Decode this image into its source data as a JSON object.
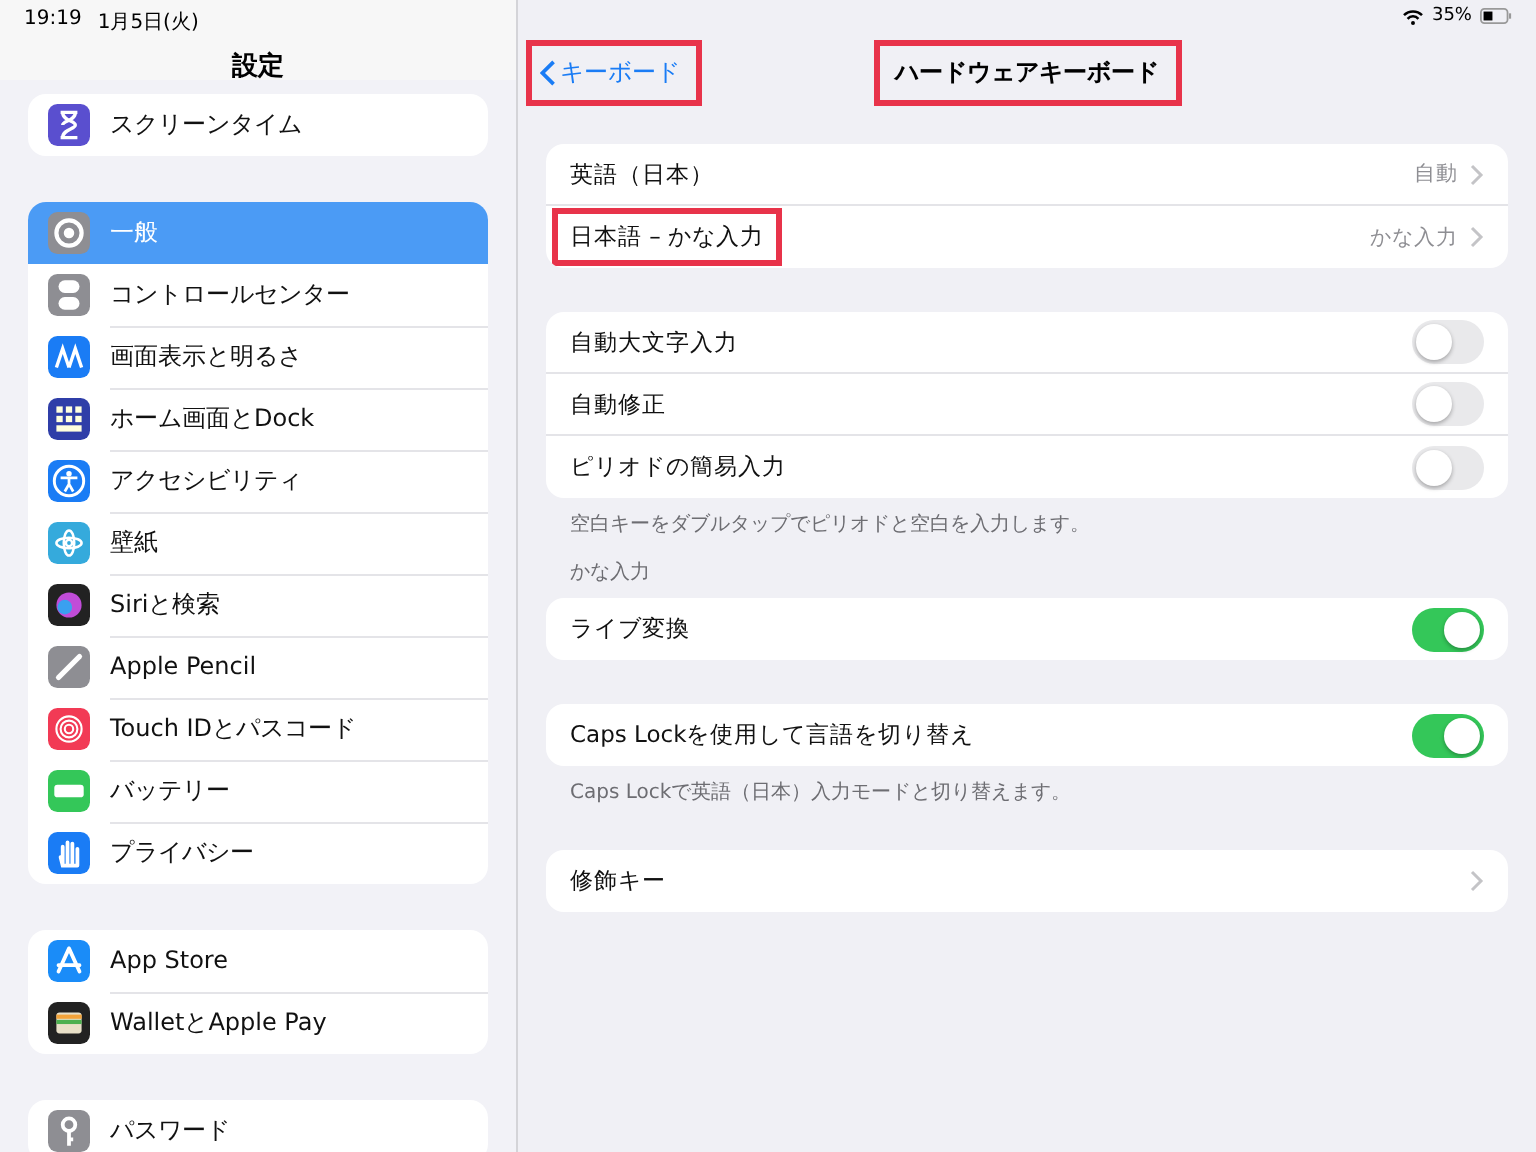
{
  "status_bar": {
    "time": "19:19",
    "date": "1月5日(火)",
    "battery": "35%"
  },
  "sidebar": {
    "title": "設定",
    "groups": [
      {
        "items": [
          {
            "label": "スクリーンタイム",
            "selected": false
          }
        ]
      },
      {
        "items": [
          {
            "label": "一般",
            "selected": true
          },
          {
            "label": "コントロールセンター",
            "selected": false
          },
          {
            "label": "画面表示と明るさ",
            "selected": false
          },
          {
            "label": "ホーム画面とDock",
            "selected": false
          },
          {
            "label": "アクセシビリティ",
            "selected": false
          },
          {
            "label": "壁紙",
            "selected": false
          },
          {
            "label": "Siriと検索",
            "selected": false
          },
          {
            "label": "Apple Pencil",
            "selected": false
          },
          {
            "label": "Touch IDとパスコード",
            "selected": false
          },
          {
            "label": "バッテリー",
            "selected": false
          },
          {
            "label": "プライバシー",
            "selected": false
          }
        ]
      },
      {
        "items": [
          {
            "label": "App Store",
            "selected": false
          },
          {
            "label": "WalletとApple Pay",
            "selected": false
          }
        ]
      },
      {
        "items": [
          {
            "label": "パスワード",
            "selected": false
          }
        ]
      }
    ]
  },
  "detail": {
    "back": {
      "label": "キーボード",
      "highlighted": true
    },
    "title": {
      "text": "ハードウェアキーボード",
      "highlighted": true
    },
    "sections": [
      {
        "rows": [
          {
            "kind": "link",
            "label": "英語（日本）",
            "value": "自動",
            "highlighted": false
          },
          {
            "kind": "link",
            "label": "日本語 – かな入力",
            "value": "かな入力",
            "highlighted": true
          }
        ]
      },
      {
        "rows": [
          {
            "kind": "toggle",
            "label": "自動大文字入力",
            "on": false,
            "highlighted": false
          },
          {
            "kind": "toggle",
            "label": "自動修正",
            "on": false,
            "highlighted": false
          },
          {
            "kind": "toggle",
            "label": "ピリオドの簡易入力",
            "on": false,
            "highlighted": false
          }
        ],
        "footer": "空白キーをダブルタップでピリオドと空白を入力します。"
      },
      {
        "header": "かな入力",
        "rows": [
          {
            "kind": "toggle",
            "label": "ライブ変換",
            "on": true,
            "highlighted": false
          }
        ]
      },
      {
        "rows": [
          {
            "kind": "toggle",
            "label": "Caps Lockを使用して言語を切り替え",
            "on": true,
            "highlighted": false
          }
        ],
        "footer": "Caps Lockで英語（日本）入力モードと切り替えます。"
      },
      {
        "rows": [
          {
            "kind": "link",
            "label": "修飾キー",
            "highlighted": false
          }
        ]
      }
    ]
  }
}
